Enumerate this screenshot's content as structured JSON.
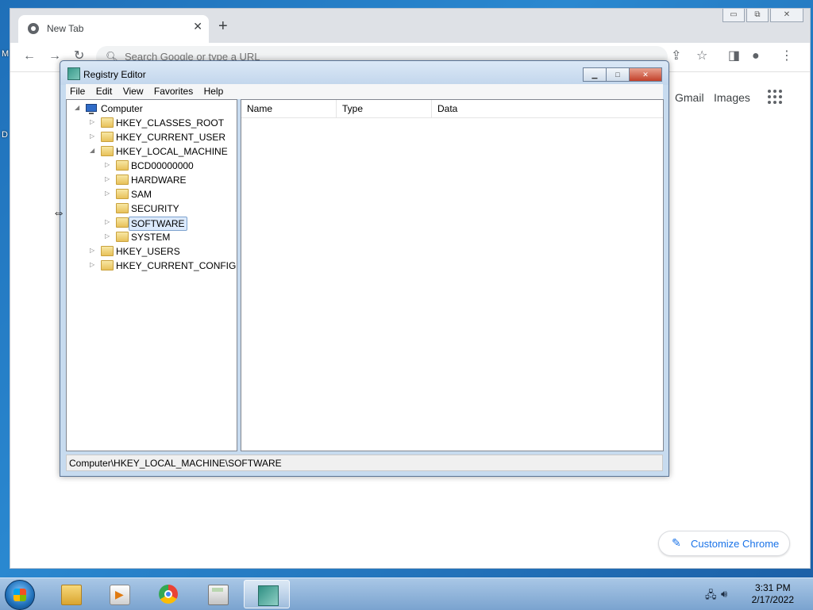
{
  "desktop": {
    "edge_letters": [
      "M",
      "D"
    ]
  },
  "chrome": {
    "tab_title": "New Tab",
    "tab_close": "✕",
    "new_tab": "+",
    "win_controls": {
      "minimize": "▭",
      "restore": "⧉",
      "close": "✕"
    },
    "omnibox_placeholder": "Search Google or type a URL",
    "links": {
      "gmail": "Gmail",
      "images": "Images"
    },
    "customize_label": "Customize Chrome"
  },
  "regedit": {
    "title": "Registry Editor",
    "controls": {
      "minimize": "▁",
      "maximize": "□",
      "close": "✕"
    },
    "menu": [
      "File",
      "Edit",
      "View",
      "Favorites",
      "Help"
    ],
    "tree": {
      "root": "Computer",
      "hives": [
        "HKEY_CLASSES_ROOT",
        "HKEY_CURRENT_USER",
        "HKEY_LOCAL_MACHINE",
        "HKEY_USERS",
        "HKEY_CURRENT_CONFIG"
      ],
      "hklm_children": [
        "BCD00000000",
        "HARDWARE",
        "SAM",
        "SECURITY",
        "SOFTWARE",
        "SYSTEM"
      ],
      "selected": "SOFTWARE"
    },
    "columns": [
      "Name",
      "Type",
      "Data"
    ],
    "status_path": "Computer\\HKEY_LOCAL_MACHINE\\SOFTWARE"
  },
  "cursor": {
    "icon": "horizontal-resize-cursor",
    "glyph": "⇔"
  },
  "taskbar": {
    "apps": [
      "Windows Explorer",
      "Windows Media Player",
      "Google Chrome",
      "Calculator",
      "Registry Editor"
    ],
    "active_app": "Registry Editor",
    "clock_time": "3:31 PM",
    "clock_date": "2/17/2022"
  }
}
